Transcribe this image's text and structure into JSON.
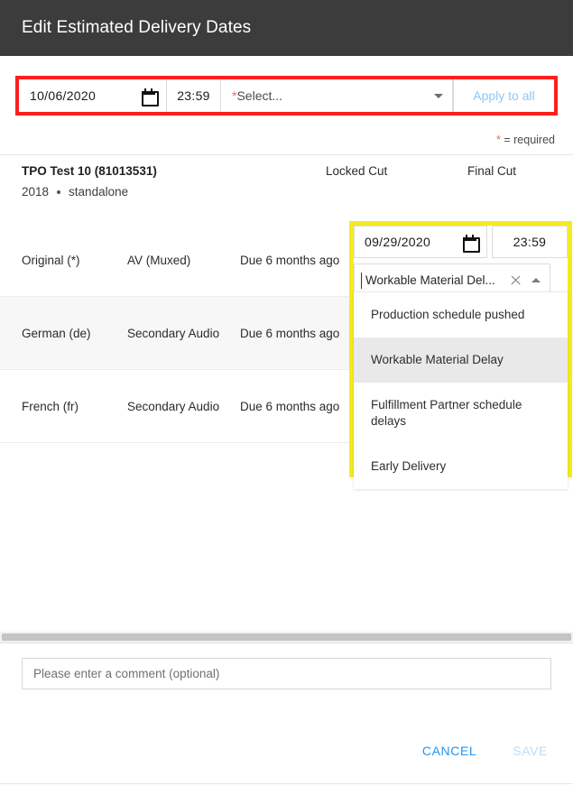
{
  "dialog": {
    "title": "Edit Estimated Delivery Dates",
    "required_note": "* = required",
    "required_star": "*"
  },
  "apply_bar": {
    "date_value": "10/06/2020",
    "time_value": "23:59",
    "calendar_icon": "calendar-icon",
    "select_star": "*",
    "select_placeholder": "Select...",
    "dropdown_icon": "chevron-down-icon",
    "apply_label": "Apply to all"
  },
  "program": {
    "name": "TPO Test 10 (81013531)",
    "year": "2018",
    "separator": "•",
    "kind": "standalone"
  },
  "columns": {
    "locked_cut": "Locked Cut",
    "final_cut": "Final Cut"
  },
  "rows": [
    {
      "language": "Original (*)",
      "type": "AV (Muxed)",
      "due": "Due 6 months ago"
    },
    {
      "language": "German (de)",
      "type": "Secondary Audio",
      "due": "Due 6 months ago"
    },
    {
      "language": "French (fr)",
      "type": "Secondary Audio",
      "due": "Due 6 months ago"
    }
  ],
  "editor": {
    "date_value": "09/29/2020",
    "time_value": "23:59",
    "calendar_icon": "calendar-icon",
    "selected_reason": "Workable Material Del...",
    "clear_icon": "close-icon",
    "collapse_icon": "chevron-up-icon"
  },
  "dropdown_options": [
    {
      "label": "Production schedule pushed",
      "selected": false
    },
    {
      "label": "Workable Material Delay",
      "selected": true
    },
    {
      "label": "Fulfillment Partner schedule delays",
      "selected": false
    },
    {
      "label": "Early Delivery",
      "selected": false
    }
  ],
  "comment": {
    "placeholder": "Please enter a comment (optional)",
    "value": ""
  },
  "footer": {
    "cancel_label": "CANCEL",
    "save_label": "SAVE"
  },
  "colors": {
    "header_bg": "#3c3c3c",
    "highlight_red": "#fc1f1f",
    "highlight_yellow": "#f3eb1d",
    "link_blue": "#2196f3",
    "disabled_blue": "#b9def8",
    "required_red": "#f4675a"
  }
}
